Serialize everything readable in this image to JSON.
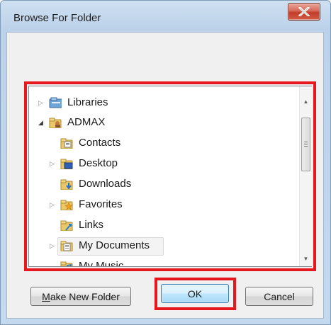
{
  "window": {
    "title": "Browse For Folder"
  },
  "tree": {
    "items": [
      {
        "label": "Libraries",
        "icon": "libraries-icon",
        "expander": "collapsed"
      },
      {
        "label": "ADMAX",
        "icon": "user-folder-icon",
        "expander": "expanded"
      },
      {
        "label": "Contacts",
        "icon": "contacts-folder-icon",
        "expander": "none"
      },
      {
        "label": "Desktop",
        "icon": "desktop-folder-icon",
        "expander": "collapsed"
      },
      {
        "label": "Downloads",
        "icon": "downloads-folder-icon",
        "expander": "none"
      },
      {
        "label": "Favorites",
        "icon": "favorites-folder-icon",
        "expander": "collapsed"
      },
      {
        "label": "Links",
        "icon": "links-folder-icon",
        "expander": "none"
      },
      {
        "label": "My Documents",
        "icon": "documents-folder-icon",
        "expander": "collapsed",
        "hovered": true
      },
      {
        "label": "My Music",
        "icon": "music-folder-icon",
        "expander": "none"
      }
    ]
  },
  "buttons": {
    "make_new_folder": {
      "mnemonic": "M",
      "rest": "ake New Folder"
    },
    "ok": "OK",
    "cancel": "Cancel"
  },
  "colors": {
    "highlight": "#e6181e",
    "ok_border": "#3c7fb1"
  }
}
